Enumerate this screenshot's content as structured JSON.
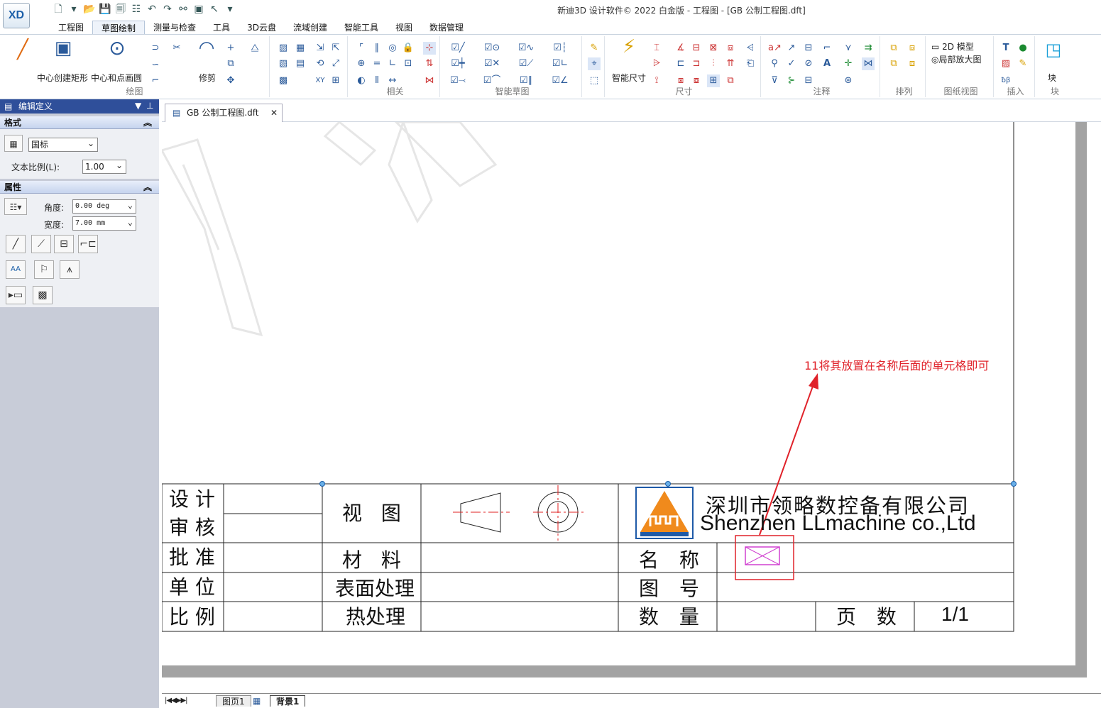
{
  "app": {
    "logo": "XD",
    "window_title": "新迪3D 设计软件© 2022 白金版 - 工程图 - [GB 公制工程图.dft]"
  },
  "menu_tabs": [
    "工程图",
    "草图绘制",
    "测量与检查",
    "工具",
    "3D云盘",
    "流域创建",
    "智能工具",
    "视图",
    "数据管理"
  ],
  "ribbon": {
    "draw_labels": {
      "rect": "中心创建矩形",
      "circle": "中心和点画圆",
      "trim": "修剪"
    },
    "groups": {
      "draw": "绘图",
      "related": "相关",
      "smart_sketch": "智能草图",
      "dimension": "尺寸",
      "annotation": "注释",
      "arrange": "排列",
      "drawing_view": "图纸视图",
      "insert": "插入",
      "block": "块"
    },
    "smart_dim": "智能尺寸",
    "model_2d": "2D 模型",
    "detail_view": "局部放大图",
    "block_label": "块"
  },
  "panel": {
    "title": "编辑定义",
    "format": {
      "title": "格式",
      "standard": "国标",
      "text_scale_label": "文本比例(L):",
      "text_scale": "1.00"
    },
    "props": {
      "title": "属性",
      "angle_label": "角度:",
      "angle": "0.00 deg",
      "width_label": "宽度:",
      "width": "7.00 mm"
    }
  },
  "doc_tab": "GB 公制工程图.dft",
  "page_tabs": {
    "sheet1": "图页1",
    "background": "背景1"
  },
  "titleblock": {
    "design": "设 计",
    "review": "审 核",
    "approve": "批 准",
    "unit": "单 位",
    "scale": "比 例",
    "view": "视 图",
    "material": "材 料",
    "surface": "表面处理",
    "heat": "热处理",
    "name": "名 称",
    "drawing_no": "图 号",
    "quantity": "数 量",
    "pages": "页 数",
    "page_value": "1/1",
    "company_cn": "深圳市领略数控备有限公司",
    "company_en": "Shenzhen LLmachine co.,Ltd"
  },
  "annotation_text": "11将其放置在名称后面的单元格即可",
  "colors": {
    "accent": "#2f4f9a",
    "annotation": "#e0222a",
    "placeholder": "#d040d0",
    "logo_orange": "#f08a1c",
    "logo_blue": "#1e5aa8"
  }
}
